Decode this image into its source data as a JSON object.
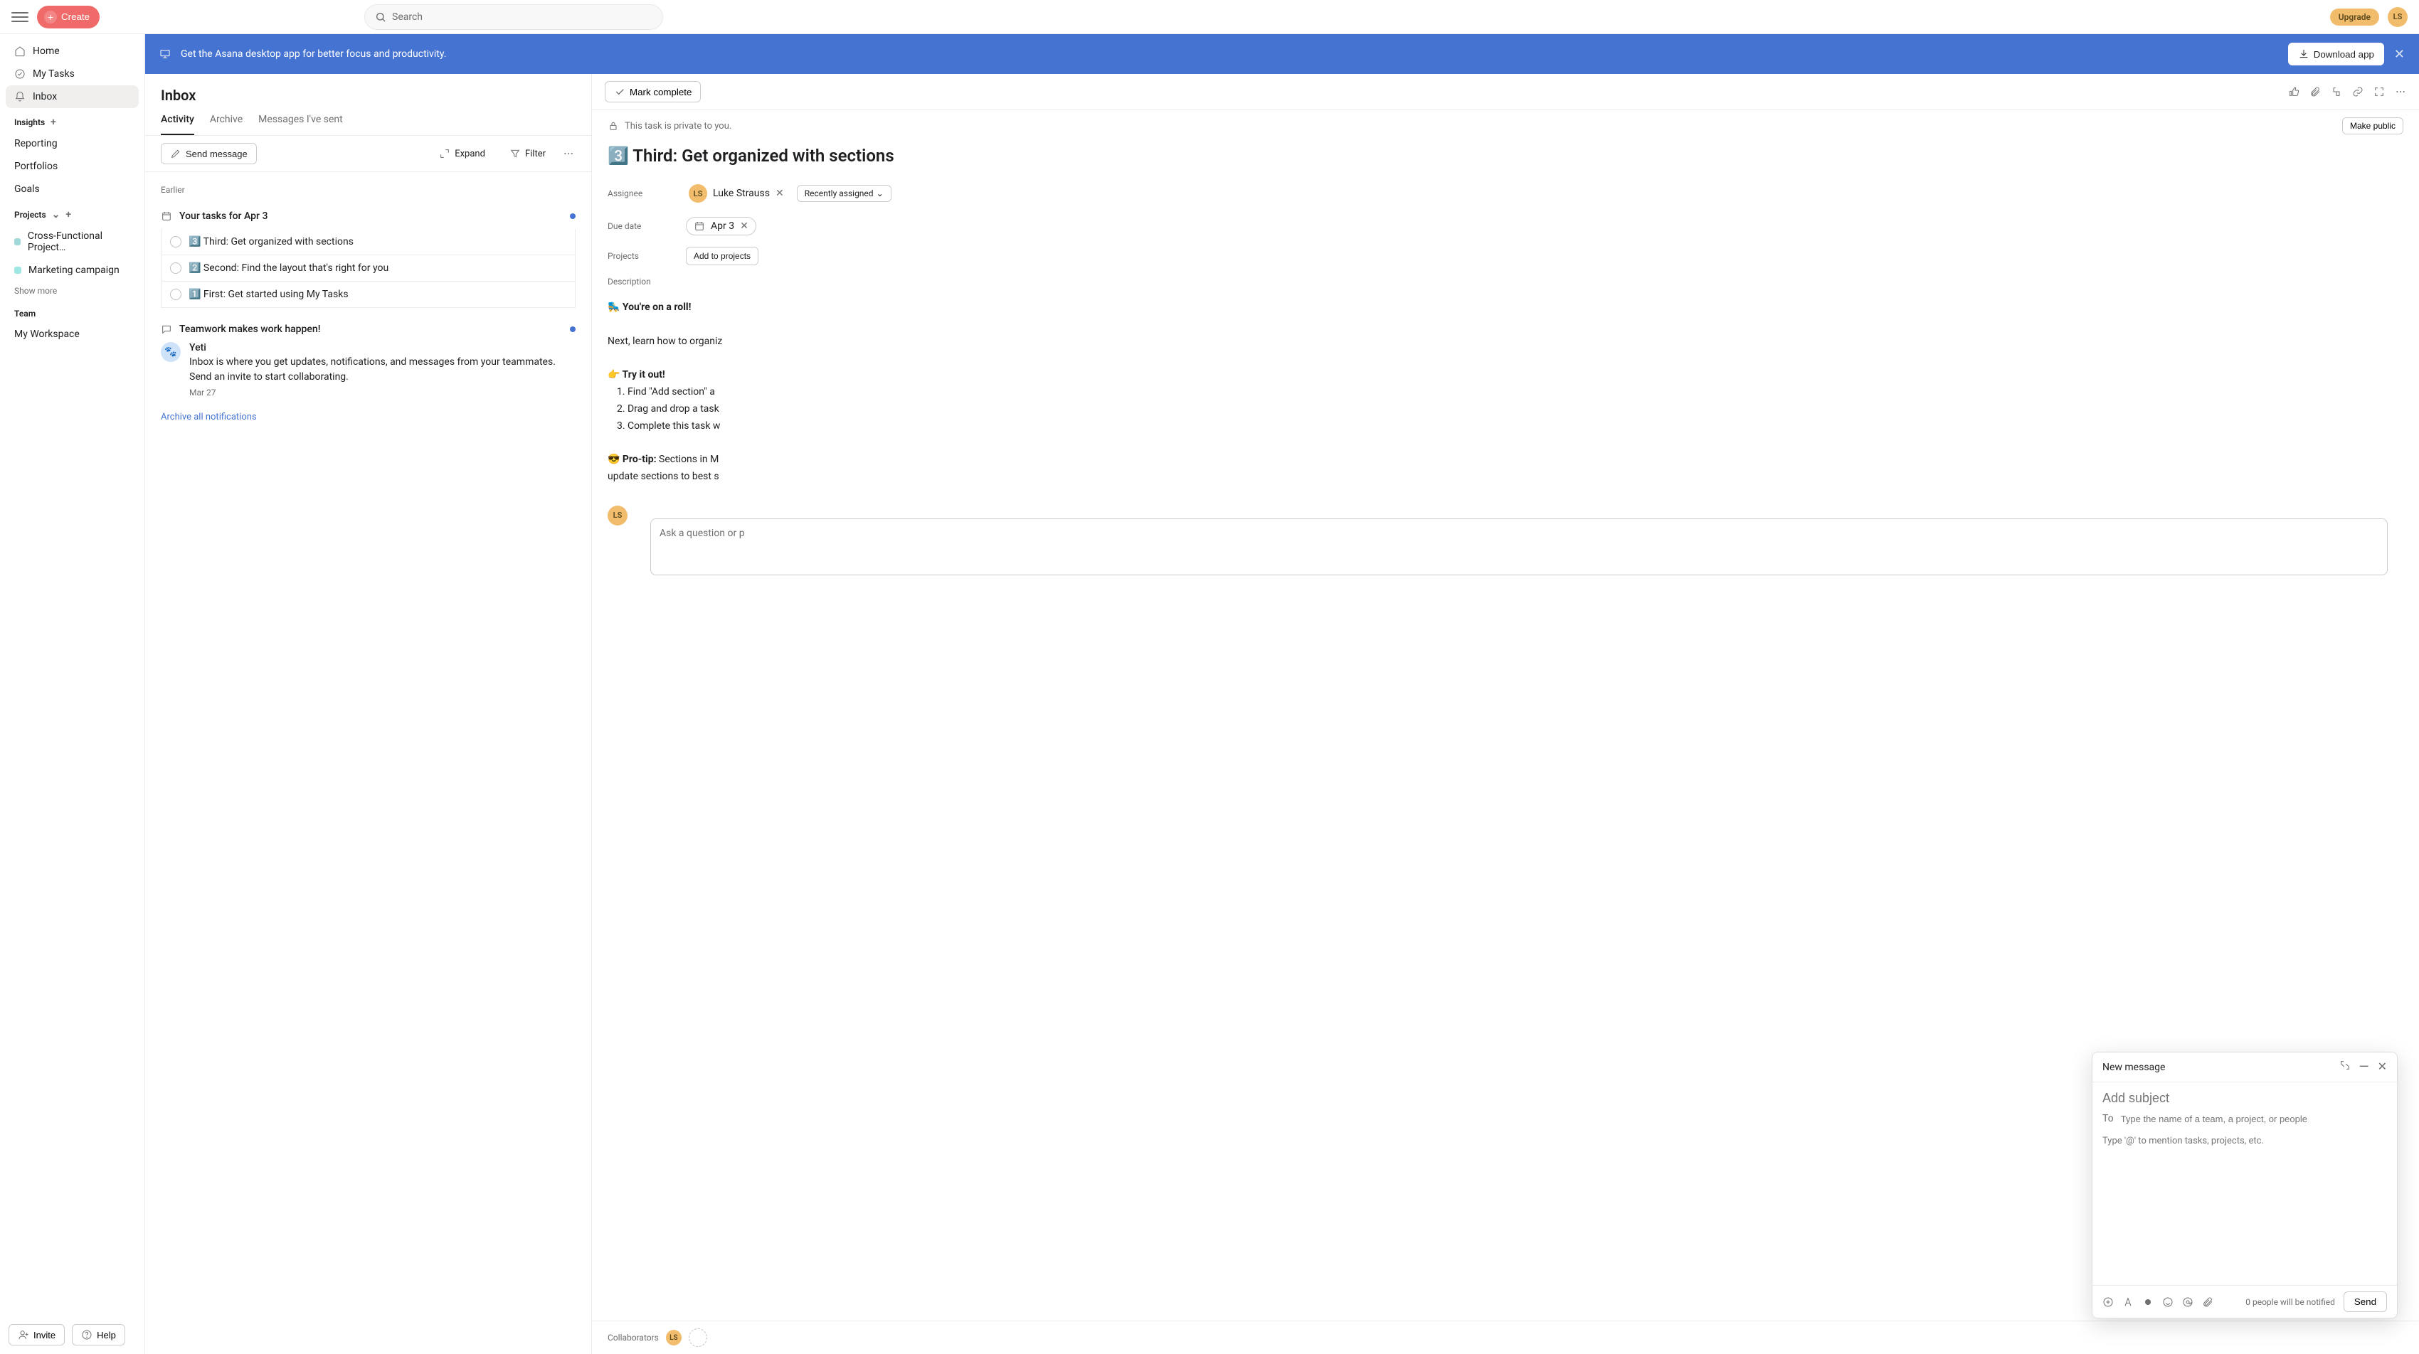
{
  "topbar": {
    "create_label": "Create",
    "search_placeholder": "Search",
    "upgrade_label": "Upgrade",
    "user_initials": "LS"
  },
  "sidebar": {
    "nav": [
      {
        "label": "Home",
        "icon": "home-icon"
      },
      {
        "label": "My Tasks",
        "icon": "check-circle-icon"
      },
      {
        "label": "Inbox",
        "icon": "bell-icon",
        "active": true
      }
    ],
    "insights_title": "Insights",
    "insights": [
      "Reporting",
      "Portfolios",
      "Goals"
    ],
    "projects_title": "Projects",
    "projects": [
      {
        "label": "Cross-Functional Project…",
        "color": "#a0d9d9"
      },
      {
        "label": "Marketing campaign",
        "color": "#9ee7e3"
      }
    ],
    "show_more": "Show more",
    "team_title": "Team",
    "team": [
      "My Workspace"
    ],
    "invite_label": "Invite",
    "help_label": "Help"
  },
  "banner": {
    "text": "Get the Asana desktop app for better focus and productivity.",
    "download_label": "Download app"
  },
  "inbox": {
    "title": "Inbox",
    "tabs": [
      "Activity",
      "Archive",
      "Messages I've sent"
    ],
    "active_tab": 0,
    "send_message": "Send message",
    "expand": "Expand",
    "filter": "Filter",
    "earlier": "Earlier",
    "group_title": "Your tasks for Apr 3",
    "tasks": [
      "3️⃣ Third: Get organized with sections",
      "2️⃣ Second: Find the layout that's right for you",
      "1️⃣ First: Get started using My Tasks"
    ],
    "teamwork_title": "Teamwork makes work happen!",
    "yeti_name": "Yeti",
    "yeti_text": "Inbox is where you get updates, notifications, and messages from your teammates. Send an invite to start collaborating.",
    "yeti_date": "Mar 27",
    "archive_all": "Archive all notifications"
  },
  "detail": {
    "mark_complete": "Mark complete",
    "privacy_text": "This task is private to you.",
    "make_public": "Make public",
    "title": "3️⃣ Third: Get organized with sections",
    "assignee_label": "Assignee",
    "assignee_name": "Luke Strauss",
    "assignee_initials": "LS",
    "recently_assigned": "Recently assigned",
    "due_date_label": "Due date",
    "due_date": "Apr 3",
    "projects_label": "Projects",
    "add_to_projects": "Add to projects",
    "description_label": "Description",
    "desc_roll": "🛼 You're on a roll!",
    "desc_next": "Next, learn how to organiz",
    "desc_try": "👉 Try it out!",
    "desc_steps": [
      "Find \"Add section\" a",
      "Drag and drop a task",
      "Complete this task w"
    ],
    "desc_protip_label": "😎 Pro-tip:",
    "desc_protip_text": " Sections in M\nupdate sections to best s",
    "comment_placeholder": "Ask a question or p",
    "collaborators_label": "Collaborators"
  },
  "popup": {
    "header": "New message",
    "subject_placeholder": "Add subject",
    "to_label": "To",
    "to_placeholder": "Type the name of a team, a project, or people",
    "body_placeholder": "Type '@' to mention tasks, projects, etc.",
    "notify_text": "0 people will be notified",
    "send_label": "Send"
  }
}
